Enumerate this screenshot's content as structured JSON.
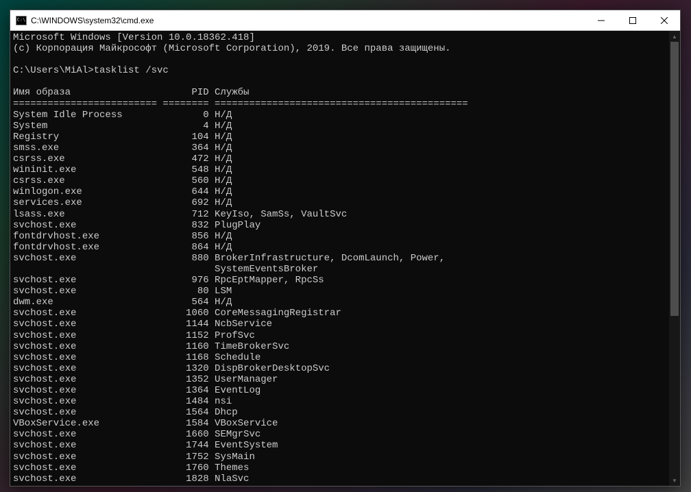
{
  "window": {
    "title": "C:\\WINDOWS\\system32\\cmd.exe"
  },
  "terminal": {
    "header1": "Microsoft Windows [Version 10.0.18362.418]",
    "header2": "(c) Корпорация Майкрософт (Microsoft Corporation), 2019. Все права защищены.",
    "prompt": "C:\\Users\\MiAl>",
    "command": "tasklist /svc",
    "columns": {
      "image": "Имя образа",
      "pid": "PID",
      "services": "Службы"
    },
    "divider": "========================= ======== ============================================",
    "processes": [
      {
        "image": "System Idle Process",
        "pid": "0",
        "services": "Н/Д"
      },
      {
        "image": "System",
        "pid": "4",
        "services": "Н/Д"
      },
      {
        "image": "Registry",
        "pid": "104",
        "services": "Н/Д"
      },
      {
        "image": "smss.exe",
        "pid": "364",
        "services": "Н/Д"
      },
      {
        "image": "csrss.exe",
        "pid": "472",
        "services": "Н/Д"
      },
      {
        "image": "wininit.exe",
        "pid": "548",
        "services": "Н/Д"
      },
      {
        "image": "csrss.exe",
        "pid": "560",
        "services": "Н/Д"
      },
      {
        "image": "winlogon.exe",
        "pid": "644",
        "services": "Н/Д"
      },
      {
        "image": "services.exe",
        "pid": "692",
        "services": "Н/Д"
      },
      {
        "image": "lsass.exe",
        "pid": "712",
        "services": "KeyIso, SamSs, VaultSvc"
      },
      {
        "image": "svchost.exe",
        "pid": "832",
        "services": "PlugPlay"
      },
      {
        "image": "fontdrvhost.exe",
        "pid": "856",
        "services": "Н/Д"
      },
      {
        "image": "fontdrvhost.exe",
        "pid": "864",
        "services": "Н/Д"
      },
      {
        "image": "svchost.exe",
        "pid": "880",
        "services": "BrokerInfrastructure, DcomLaunch, Power,",
        "cont": "SystemEventsBroker"
      },
      {
        "image": "svchost.exe",
        "pid": "976",
        "services": "RpcEptMapper, RpcSs"
      },
      {
        "image": "svchost.exe",
        "pid": "80",
        "services": "LSM"
      },
      {
        "image": "dwm.exe",
        "pid": "564",
        "services": "Н/Д"
      },
      {
        "image": "svchost.exe",
        "pid": "1060",
        "services": "CoreMessagingRegistrar"
      },
      {
        "image": "svchost.exe",
        "pid": "1144",
        "services": "NcbService"
      },
      {
        "image": "svchost.exe",
        "pid": "1152",
        "services": "ProfSvc"
      },
      {
        "image": "svchost.exe",
        "pid": "1160",
        "services": "TimeBrokerSvc"
      },
      {
        "image": "svchost.exe",
        "pid": "1168",
        "services": "Schedule"
      },
      {
        "image": "svchost.exe",
        "pid": "1320",
        "services": "DispBrokerDesktopSvc"
      },
      {
        "image": "svchost.exe",
        "pid": "1352",
        "services": "UserManager"
      },
      {
        "image": "svchost.exe",
        "pid": "1364",
        "services": "EventLog"
      },
      {
        "image": "svchost.exe",
        "pid": "1484",
        "services": "nsi"
      },
      {
        "image": "svchost.exe",
        "pid": "1564",
        "services": "Dhcp"
      },
      {
        "image": "VBoxService.exe",
        "pid": "1584",
        "services": "VBoxService"
      },
      {
        "image": "svchost.exe",
        "pid": "1660",
        "services": "SEMgrSvc"
      },
      {
        "image": "svchost.exe",
        "pid": "1744",
        "services": "EventSystem"
      },
      {
        "image": "svchost.exe",
        "pid": "1752",
        "services": "SysMain"
      },
      {
        "image": "svchost.exe",
        "pid": "1760",
        "services": "Themes"
      },
      {
        "image": "svchost.exe",
        "pid": "1828",
        "services": "NlaSvc"
      }
    ]
  }
}
